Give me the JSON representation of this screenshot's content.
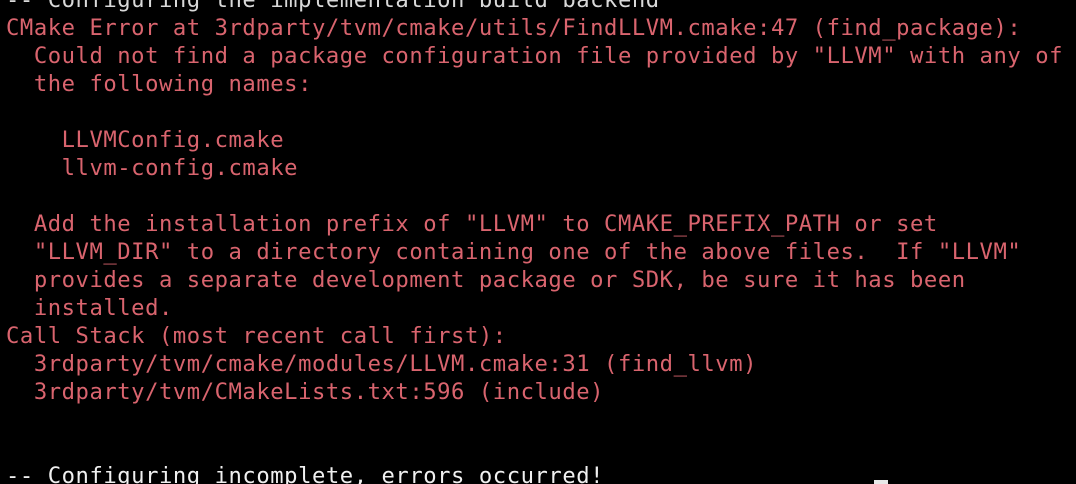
{
  "terminal": {
    "partial_top_line": "-- Configuring the implementation build backend",
    "lines": [
      {
        "text": "CMake Error at 3rdparty/tvm/cmake/utils/FindLLVM.cmake:47 (find_package):",
        "kind": "error"
      },
      {
        "text": "  Could not find a package configuration file provided by \"LLVM\" with any of",
        "kind": "error"
      },
      {
        "text": "  the following names:",
        "kind": "error"
      },
      {
        "text": "",
        "kind": "error"
      },
      {
        "text": "    LLVMConfig.cmake",
        "kind": "error"
      },
      {
        "text": "    llvm-config.cmake",
        "kind": "error"
      },
      {
        "text": "",
        "kind": "error"
      },
      {
        "text": "  Add the installation prefix of \"LLVM\" to CMAKE_PREFIX_PATH or set",
        "kind": "error"
      },
      {
        "text": "  \"LLVM_DIR\" to a directory containing one of the above files.  If \"LLVM\"",
        "kind": "error"
      },
      {
        "text": "  provides a separate development package or SDK, be sure it has been",
        "kind": "error"
      },
      {
        "text": "  installed.",
        "kind": "error"
      },
      {
        "text": "Call Stack (most recent call first):",
        "kind": "error"
      },
      {
        "text": "  3rdparty/tvm/cmake/modules/LLVM.cmake:31 (find_llvm)",
        "kind": "error"
      },
      {
        "text": "  3rdparty/tvm/CMakeLists.txt:596 (include)",
        "kind": "error"
      },
      {
        "text": "",
        "kind": "error"
      },
      {
        "text": "",
        "kind": "error"
      },
      {
        "text": "-- Configuring incomplete, errors occurred!",
        "kind": "normal"
      }
    ]
  },
  "colors": {
    "background": "#000000",
    "error_text": "#d9646e",
    "normal_text": "#f0f0f0",
    "cursor": "#e8e8e8"
  }
}
